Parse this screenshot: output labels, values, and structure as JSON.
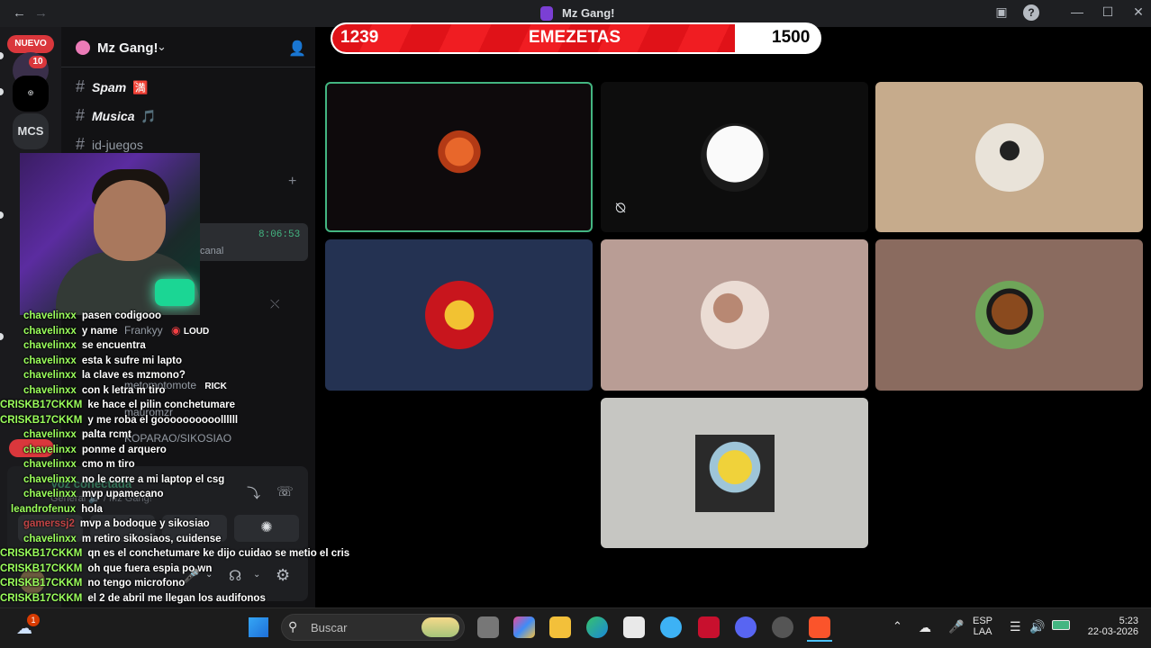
{
  "window": {
    "title": "Mz Gang!"
  },
  "rail": {
    "nuevo_label": "NUEVO",
    "unread_count": "10",
    "server_mcs": "MCS"
  },
  "sidebar": {
    "server_name": "Mz Gang!",
    "channels": [
      {
        "name": "Spam",
        "emoji": "🈵"
      },
      {
        "name": "Musica",
        "emoji": "🎵"
      },
      {
        "name": "id-juegos"
      }
    ],
    "timestamp": "8:06:53",
    "canal_label": "canal",
    "voice_users": [
      {
        "name": "Frankyy",
        "tag": "LOUD"
      },
      {
        "name": "metomotomote",
        "tag": "RICK"
      },
      {
        "name": "mauromzr"
      },
      {
        "name": "KOPARAO/SIKOSIAO"
      }
    ],
    "voice_status": "Voz conectada",
    "voice_channel": "General 🔊 / Mz Gang!"
  },
  "chat": [
    {
      "user": "chavelinxx",
      "text": "pasen codigooo"
    },
    {
      "user": "chavelinxx",
      "text": "y name"
    },
    {
      "user": "chavelinxx",
      "text": "se encuentra"
    },
    {
      "user": "chavelinxx",
      "text": "esta k sufre mi lapto"
    },
    {
      "user": "chavelinxx",
      "text": "la clave es mzmono?"
    },
    {
      "user": "chavelinxx",
      "text": "con k letra m tiro"
    },
    {
      "user": "CRISKB17CKKM",
      "text": "ke hace el pilin conchetumare"
    },
    {
      "user": "CRISKB17CKKM",
      "text": "y me roba el goooooooooollllll"
    },
    {
      "user": "chavelinxx",
      "text": "palta rcmt"
    },
    {
      "user": "chavelinxx",
      "text": "ponme d arquero"
    },
    {
      "user": "chavelinxx",
      "text": "cmo m tiro"
    },
    {
      "user": "chavelinxx",
      "text": "no le corre a mi laptop el csg"
    },
    {
      "user": "chavelinxx",
      "text": "mvp upamecano"
    },
    {
      "user": "leandrofenux",
      "text": "hola"
    },
    {
      "user": "gamerssj2",
      "text": "mvp a bodoque y sikosiao"
    },
    {
      "user": "chavelinxx",
      "text": "m retiro sikosiaos, cuidense"
    },
    {
      "user": "CRISKB17CKKM",
      "text": "qn es el conchetumare ke dijo cuidao se metio el cris"
    },
    {
      "user": "CRISKB17CKKM",
      "text": "oh que fuera espia po wn"
    },
    {
      "user": "CRISKB17CKKM",
      "text": "no tengo microfono"
    },
    {
      "user": "CRISKB17CKKM",
      "text": "el 2 de abril me llegan los audifonos"
    }
  ],
  "goal_bar": {
    "current": "1239",
    "label": "EMEZETAS",
    "goal": "1500",
    "progress": 0.826
  },
  "tiles": [
    {
      "name": "crash-tile",
      "bg": "#0e0a0c",
      "avatar_color": "#c8501e",
      "speaking": true
    },
    {
      "name": "am-logo-tile",
      "bg": "#0d0d0d",
      "avatar_color": "#f2f2f2",
      "muted": true
    },
    {
      "name": "girl-avatar-tile",
      "bg": "#c6ab8c",
      "avatar_color": "#e6e0d6"
    },
    {
      "name": "soviet-avatar-tile",
      "bg": "#243252",
      "avatar_color": "#c8151d"
    },
    {
      "name": "blurred-avatar-tile",
      "bg": "#b99d95",
      "avatar_color": "#e9d8cf"
    },
    {
      "name": "cartoon-avatar-tile",
      "bg": "#8a6b5f",
      "avatar_color": "#5a8f47"
    },
    {
      "name": "minion-avatar-tile",
      "bg": "#c6c6c2",
      "avatar_color": "#e8cf3a"
    }
  ],
  "taskbar": {
    "search_placeholder": "Buscar",
    "weather_badge": "1",
    "lang_top": "ESP",
    "lang_bottom": "LAA",
    "time": "5:23",
    "date": "22-03-2026"
  },
  "colors": {
    "accent_green": "#43b581",
    "bar_red": "#e01218",
    "chat_user": "#9bff5c"
  }
}
